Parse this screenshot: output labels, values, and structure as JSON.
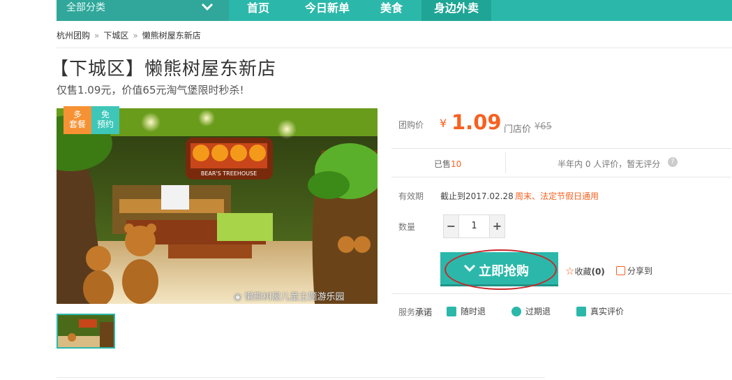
{
  "nav": {
    "category_label": "全部分类",
    "items": [
      {
        "label": "首页"
      },
      {
        "label": "今日新单"
      },
      {
        "label": "美食"
      },
      {
        "label": "身边外卖"
      }
    ]
  },
  "breadcrumb": [
    "杭州团购",
    "下城区",
    "懒熊树屋东新店"
  ],
  "deal": {
    "title": "【下城区】懒熊树屋东新店",
    "subtitle": "仅售1.09元，价值65元淘气堡限时秒杀!"
  },
  "badges": {
    "orange": [
      "多",
      "套餐"
    ],
    "teal": [
      "免",
      "预约"
    ]
  },
  "image": {
    "watermark": "懒熊树屋儿童主题游乐园",
    "sign_text": "BEAR'S TREEHOUSE"
  },
  "price": {
    "label": "团购价",
    "currency": "¥",
    "value": "1.09",
    "store_label": "门店价",
    "store_value": "¥65"
  },
  "sales": {
    "sold_label": "已售",
    "sold_count": "10",
    "rating_text": "半年内 0 人评价，暂无评分",
    "help": "?"
  },
  "validity": {
    "label": "有效期",
    "value": "截止到2017.02.28",
    "note": "周末、法定节假日通用"
  },
  "quantity": {
    "label": "数量",
    "minus": "−",
    "value": "1",
    "plus": "+"
  },
  "actions": {
    "buy_label": "立即抢购",
    "fav_label": "收藏",
    "fav_count": "(0)",
    "share_label": "分享到"
  },
  "service": {
    "label_prefix": "服务",
    "label_highlight": "承诺",
    "items": [
      "随时退",
      "过期退",
      "真实评价"
    ]
  },
  "colors": {
    "brand": "#2bb8aa",
    "price": "#f76120",
    "annotation": "#c8282a"
  }
}
